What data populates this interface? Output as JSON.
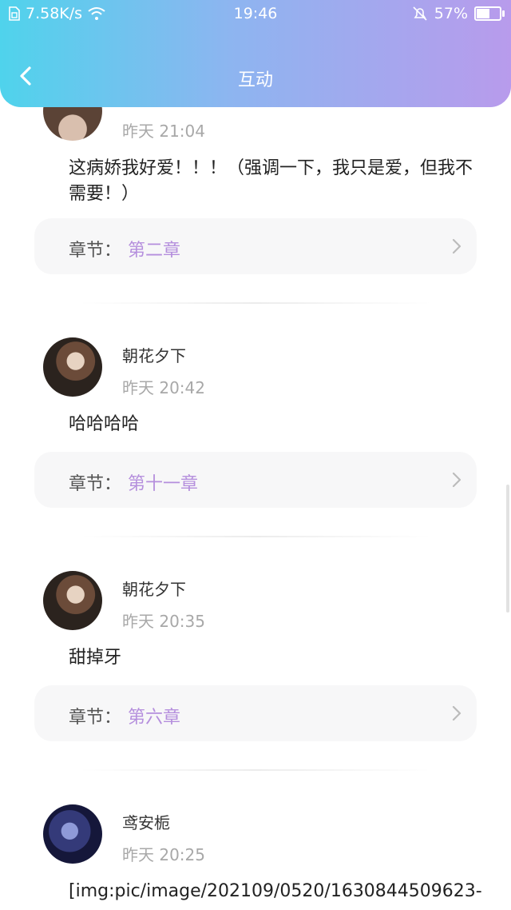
{
  "status_bar": {
    "speed": "7.58K/s",
    "time": "19:46",
    "battery": "57%",
    "battery_level": 0.57
  },
  "header": {
    "title": "互动"
  },
  "comments": [
    {
      "username": "",
      "time": "昨天 21:04",
      "content": "这病娇我好爱！！！（强调一下，我只是爱，但我不需要！）",
      "chapter_label": "章节：",
      "chapter": "第二章"
    },
    {
      "username": "朝花夕下",
      "time": "昨天 20:42",
      "content": "哈哈哈哈",
      "chapter_label": "章节：",
      "chapter": "第十一章"
    },
    {
      "username": "朝花夕下",
      "time": "昨天 20:35",
      "content": "甜掉牙",
      "chapter_label": "章节：",
      "chapter": "第六章"
    },
    {
      "username": "鸢安栀",
      "time": "昨天 20:25",
      "content": "[img:pic/image/202109/0520/1630844509623-",
      "chapter_label": "",
      "chapter": ""
    }
  ],
  "icons": {
    "back": "chevron-left-icon",
    "chevron": "chevron-right-icon",
    "wifi": "wifi-icon",
    "mute": "bell-muted-icon",
    "battery": "battery-icon"
  },
  "colors": {
    "header_start": "#4fd3ec",
    "header_end": "#b89bec",
    "chapter_accent": "#b58fdd"
  }
}
